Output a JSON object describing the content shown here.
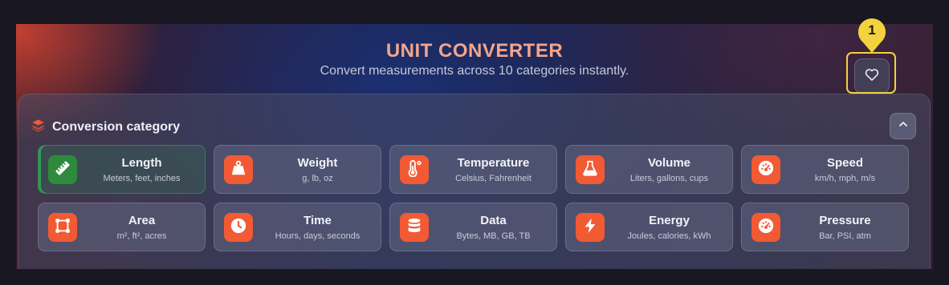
{
  "header": {
    "title": "UNIT CONVERTER",
    "subtitle": "Convert measurements across 10 categories instantly."
  },
  "favorite_button": {
    "icon": "heart-icon"
  },
  "category_panel": {
    "title": "Conversion category",
    "title_icon": "layers-icon",
    "collapse_icon": "chevron-up-icon",
    "selected": "Length",
    "categories": [
      {
        "name": "Length",
        "desc": "Meters, feet, inches",
        "icon": "ruler-icon"
      },
      {
        "name": "Weight",
        "desc": "g, lb, oz",
        "icon": "weight-icon"
      },
      {
        "name": "Temperature",
        "desc": "Celsius, Fahrenheit",
        "icon": "thermometer-icon"
      },
      {
        "name": "Volume",
        "desc": "Liters, gallons, cups",
        "icon": "flask-icon"
      },
      {
        "name": "Speed",
        "desc": "km/h, mph, m/s",
        "icon": "gauge-icon"
      },
      {
        "name": "Area",
        "desc": "m², ft², acres",
        "icon": "area-icon"
      },
      {
        "name": "Time",
        "desc": "Hours, days, seconds",
        "icon": "clock-icon"
      },
      {
        "name": "Data",
        "desc": "Bytes, MB, GB, TB",
        "icon": "database-icon"
      },
      {
        "name": "Energy",
        "desc": "Joules, calories, kWh",
        "icon": "bolt-icon"
      },
      {
        "name": "Pressure",
        "desc": "Bar, PSI, atm",
        "icon": "gauge-icon"
      }
    ]
  },
  "annotation": {
    "badge": "1",
    "color": "#f3d23e"
  },
  "colors": {
    "accent": "#f25a34",
    "selected_icon": "#2e8a3c",
    "title": "#f5a58a"
  }
}
